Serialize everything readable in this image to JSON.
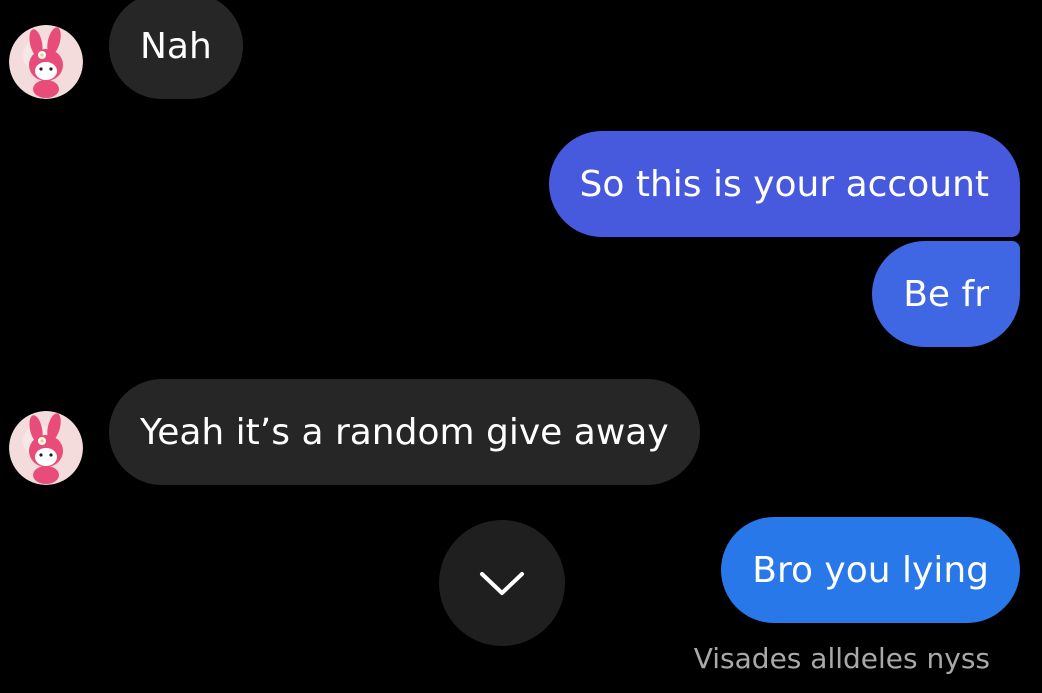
{
  "messages": [
    {
      "direction": "received",
      "text": "Nah"
    },
    {
      "direction": "sent",
      "text": "So this is your account"
    },
    {
      "direction": "sent",
      "text": "Be fr"
    },
    {
      "direction": "received",
      "text": "Yeah it’s a random give away"
    },
    {
      "direction": "sent",
      "text": "Bro you lying"
    }
  ],
  "seen_status": "Visades alldeles nyss",
  "scroll_button_icon": "chevron-down-icon",
  "avatar_icon": "my-melody-avatar-icon",
  "colors": {
    "background": "#000000",
    "received_bubble": "#262626",
    "sent_bubble_top": "#4759dd",
    "sent_bubble_mid": "#3f66e3",
    "sent_bubble_bottom": "#2878e9",
    "scroll_button": "#1f1f1f",
    "seen_text": "#a9a9a9"
  }
}
